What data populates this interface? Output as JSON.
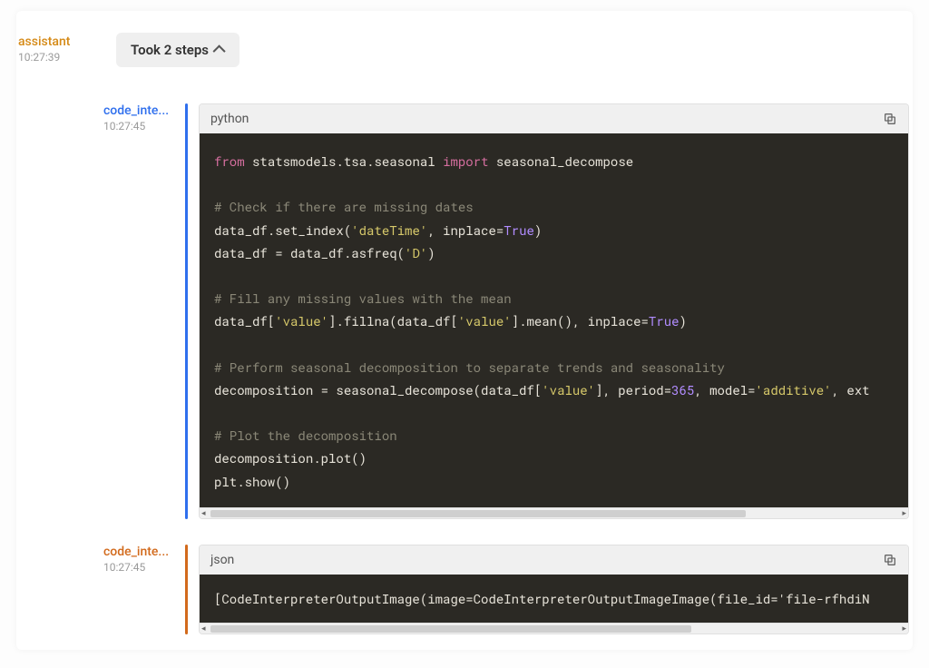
{
  "assistant": {
    "role": "assistant",
    "timestamp": "10:27:39",
    "chip_label": "Took 2 steps"
  },
  "code_input": {
    "role": "code_inte...",
    "timestamp": "10:27:45",
    "language": "python",
    "code": {
      "l1a": "from",
      "l1b": "statsmodels.tsa.seasonal",
      "l1c": "import",
      "l1d": "seasonal_decompose",
      "l3": "# Check if there are missing dates",
      "l4a": "data_df.set_index(",
      "l4b": "'dateTime'",
      "l4c": ", inplace=",
      "l4d": "True",
      "l4e": ")",
      "l5a": "data_df = data_df.asfreq(",
      "l5b": "'D'",
      "l5c": ")",
      "l7": "# Fill any missing values with the mean",
      "l8a": "data_df[",
      "l8b": "'value'",
      "l8c": "].fillna(data_df[",
      "l8d": "'value'",
      "l8e": "].mean(), inplace=",
      "l8f": "True",
      "l8g": ")",
      "l10": "# Perform seasonal decomposition to separate trends and seasonality",
      "l11a": "decomposition = seasonal_decompose(data_df[",
      "l11b": "'value'",
      "l11c": "], period=",
      "l11d": "365",
      "l11e": ", model=",
      "l11f": "'additive'",
      "l11g": ", ext",
      "l13": "# Plot the decomposition",
      "l14": "decomposition.plot()",
      "l15": "plt.show()"
    }
  },
  "code_output": {
    "role": "code_inte...",
    "timestamp": "10:27:45",
    "language": "json",
    "text": "[CodeInterpreterOutputImage(image=CodeInterpreterOutputImageImage(file_id='file-rfhdiN"
  }
}
